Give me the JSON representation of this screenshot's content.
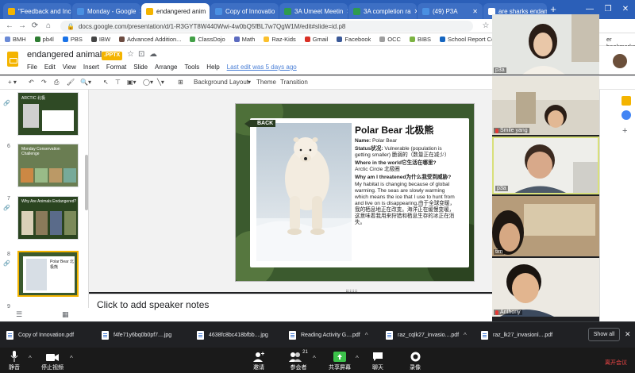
{
  "browser": {
    "tabs": [
      {
        "label": "\"Feedback and Incen",
        "color": "#f4b400"
      },
      {
        "label": "Monday - Google",
        "color": "#4a90e2"
      },
      {
        "label": "endangered anim",
        "color": "#f4b400"
      },
      {
        "label": "Copy of Innovatio",
        "color": "#4a90e2"
      },
      {
        "label": "3A Umeet Meetin",
        "color": "#2e9b4f"
      },
      {
        "label": "3A completion ra",
        "color": "#2e9b4f"
      },
      {
        "label": "(49) P3A",
        "color": "#4a90e2"
      },
      {
        "label": "are sharks endang",
        "color": "#fff"
      }
    ],
    "new_tab": "+",
    "url": "docs.google.com/presentation/d/1-R3GYT8W440Wwi-4w0bQ5fBL7w7QgW1M/edit#slide=id.p8",
    "bookmarks": [
      {
        "label": "BMH",
        "color": "#6a8ad6"
      },
      {
        "label": "pb4l",
        "color": "#2e7d32"
      },
      {
        "label": "PBS",
        "color": "#1a73e8"
      },
      {
        "label": "IBW",
        "color": "#444"
      },
      {
        "label": "Advanced Addition...",
        "color": "#6d4c41"
      },
      {
        "label": "ClassDojo",
        "color": "#43a047"
      },
      {
        "label": "Math",
        "color": "#5c6bc0"
      },
      {
        "label": "Raz-Kids",
        "color": "#fbc02d"
      },
      {
        "label": "Gmail",
        "color": "#d93025"
      },
      {
        "label": "Facebook",
        "color": "#3b5998"
      },
      {
        "label": "OCC",
        "color": "#9e9e9e"
      },
      {
        "label": "BIBS",
        "color": "#7cb342"
      },
      {
        "label": "School Report Com...",
        "color": "#1565c0"
      },
      {
        "label": "bank",
        "color": "#333"
      }
    ],
    "other_bookmarks": "er bookmarks"
  },
  "slides": {
    "doc_title": "endangered animals",
    "badge": ".PPTX",
    "menus": [
      "File",
      "Edit",
      "View",
      "Insert",
      "Format",
      "Slide",
      "Arrange",
      "Tools",
      "Help"
    ],
    "last_edit": "Last edit was 5 days ago",
    "toolbar": {
      "background": "Background",
      "layout": "Layout",
      "theme": "Theme",
      "transition": "Transition"
    },
    "thumbnails": [
      {
        "num": "",
        "title": "ARCTIC 北极"
      },
      {
        "num": "6",
        "title": "Monday Conservation Challenge"
      },
      {
        "num": "7",
        "title": "Why Are Animals Endangered?"
      },
      {
        "num": "8",
        "title": "Polar Bear 北极熊"
      },
      {
        "num": "9",
        "title": ""
      }
    ],
    "speaker_notes": "Click to add speaker notes",
    "slide": {
      "back": "BACK",
      "title": "Polar Bear 北极熊",
      "name_label": "Name:",
      "name_value": "Polar Bear",
      "status_label": "Status状况:",
      "status_value": "Vulnerable (population is getting smaller) 脆弱的（数量正在减少）",
      "where_label": "Where in the world它生活在哪里?",
      "where_value": "Arctic Circle 北极圈",
      "why_label": "Why am I threatened为什么我受到威胁?",
      "why_value": "My habitat is changing because of global warming. The seas are slowly warming which means the ice that I use to hunt from and live on is disappearing.由于全球变暖，我的栖息地正在改变。海洋正在缓慢变暖，这意味着我用来狩猎和栖息生存的冰正在消失。"
    }
  },
  "meeting": {
    "participants": [
      "p3a",
      "Smile yang",
      "p3a",
      "tim",
      "Anthony"
    ],
    "controls": {
      "mute": "静音",
      "stop_video": "停止视频",
      "invite": "邀请",
      "participants": "参会者",
      "participants_count": "21",
      "share": "共享屏幕",
      "chat": "聊天",
      "record": "录像",
      "leave": "离开会议"
    }
  },
  "downloads": {
    "files": [
      "Copy of Innovation.pdf",
      "f4fe71y6bq0b0pf7....jpg",
      "4638fc8bc418bfbb....jpg",
      "Reading Activity G....pdf",
      "raz_cqlk27_invasio....pdf",
      "raz_lk27_invasionl....pdf"
    ],
    "show_all": "Show all"
  }
}
